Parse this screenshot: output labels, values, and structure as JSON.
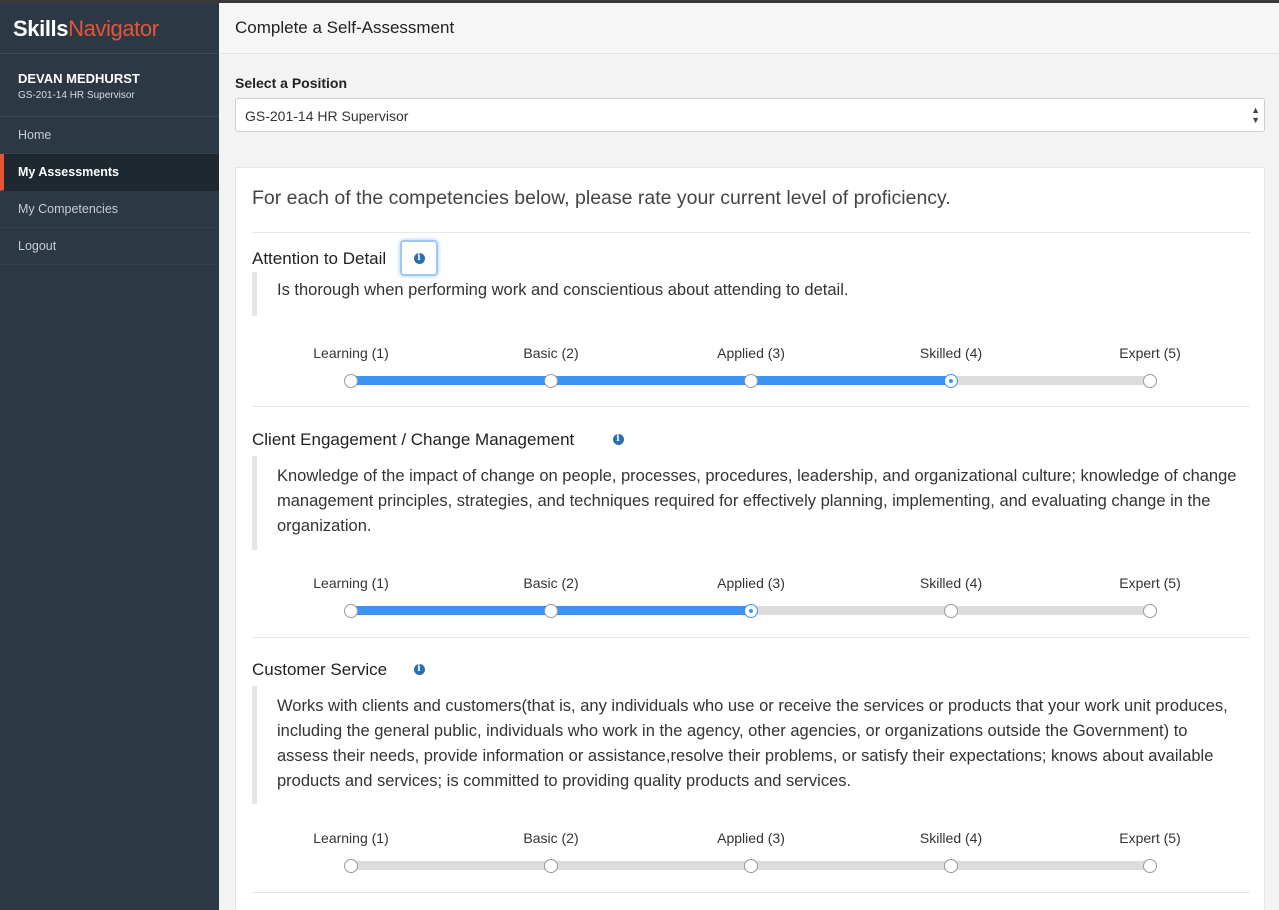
{
  "brand": {
    "part1": "Skills",
    "part2": "Navigator"
  },
  "user": {
    "name": "DEVAN MEDHURST",
    "role": "GS-201-14 HR Supervisor"
  },
  "nav": [
    {
      "label": "Home",
      "active": false
    },
    {
      "label": "My Assessments",
      "active": true
    },
    {
      "label": "My Competencies",
      "active": false
    },
    {
      "label": "Logout",
      "active": false
    }
  ],
  "page": {
    "title": "Complete a Self-Assessment"
  },
  "position": {
    "label": "Select a Position",
    "selected": "GS-201-14 HR Supervisor"
  },
  "intro": "For each of the competencies below, please rate your current level of proficiency.",
  "levels": [
    "Learning (1)",
    "Basic (2)",
    "Applied (3)",
    "Skilled (4)",
    "Expert (5)"
  ],
  "competencies": [
    {
      "title": "Attention to Detail",
      "description": "Is thorough when performing work and conscientious about attending to detail.",
      "rating": 4
    },
    {
      "title": "Client Engagement / Change Management",
      "description": "Knowledge of the impact of change on people, processes, procedures, leadership, and organizational culture; knowledge of change management principles, strategies, and techniques required for effectively planning, implementing, and evaluating change in the organization.",
      "rating": 3
    },
    {
      "title": "Customer Service",
      "description": "Works with clients and customers(that is, any individuals who use or receive the services or products that your work unit produces, including the general public, individuals who work in the agency, other agencies, or organizations outside the Government) to assess their needs, provide information or assistance,resolve their problems, or satisfy their expectations; knows about available products and services; is committed to providing quality products and services.",
      "rating": 0
    }
  ]
}
